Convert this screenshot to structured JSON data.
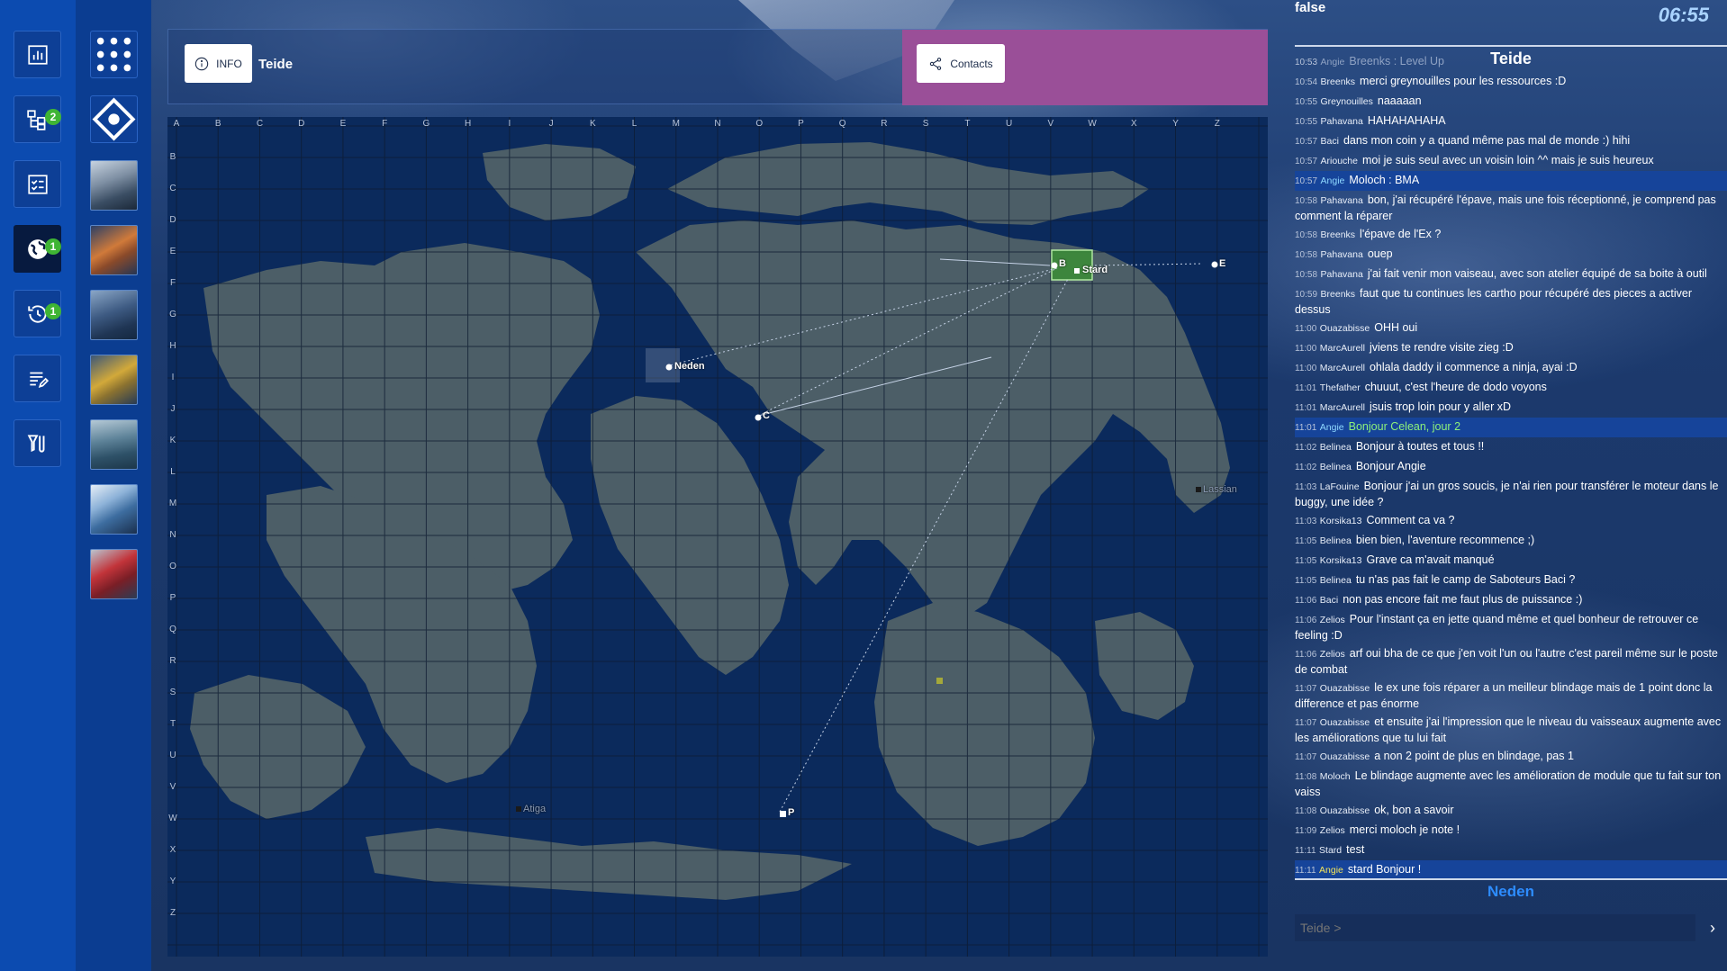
{
  "status_text": "false",
  "clock": "06:55",
  "topbar": {
    "info_label": "INFO",
    "location": "Teide",
    "contacts_label": "Contacts"
  },
  "nav": {
    "badges": {
      "hierarchy": "2",
      "world": "1",
      "history": "1"
    }
  },
  "map": {
    "columns": [
      "A",
      "B",
      "C",
      "D",
      "E",
      "F",
      "G",
      "H",
      "I",
      "J",
      "K",
      "L",
      "M",
      "N",
      "O",
      "P",
      "Q",
      "R",
      "S",
      "T",
      "U",
      "V",
      "W",
      "X",
      "Y",
      "Z"
    ],
    "rows": [
      "A",
      "B",
      "C",
      "D",
      "E",
      "F",
      "G",
      "H",
      "I",
      "J",
      "K",
      "L",
      "M",
      "N",
      "O",
      "P",
      "Q",
      "R",
      "S",
      "T",
      "U",
      "V",
      "W",
      "X",
      "Y",
      "Z"
    ],
    "markers": {
      "neden": "Neden",
      "c": "C",
      "b": "B",
      "stard": "Stard",
      "e": "E",
      "lassian": "Lassian",
      "atiga": "Atiga",
      "p": "P"
    }
  },
  "chat": {
    "channel": "Teide",
    "footer_channel": "Neden",
    "input_placeholder": "Teide >",
    "send_icon": "chevron-right-icon",
    "messages": [
      {
        "time": "10:53",
        "user": "Angie",
        "text": "Breenks : Level Up",
        "style": "dim"
      },
      {
        "time": "10:54",
        "user": "Breenks",
        "text": "merci greynouilles pour les ressources :D",
        "style": ""
      },
      {
        "time": "10:55",
        "user": "Greynouilles",
        "text": "naaaaan",
        "style": ""
      },
      {
        "time": "10:55",
        "user": "Pahavana",
        "text": "HAHAHAHAHA",
        "style": ""
      },
      {
        "time": "10:57",
        "user": "Baci",
        "text": "dans mon coin y a quand même pas mal de monde :) hihi",
        "style": ""
      },
      {
        "time": "10:57",
        "user": "Ariouche",
        "text": "moi je suis seul avec un voisin loin ^^ mais je suis heureux",
        "style": ""
      },
      {
        "time": "10:57",
        "user": "Angie",
        "text": "Moloch : BMA",
        "style": "hl"
      },
      {
        "time": "10:58",
        "user": "Pahavana",
        "text": "bon, j'ai récupéré l'épave, mais une fois réceptionné, je comprend pas comment la réparer",
        "style": ""
      },
      {
        "time": "10:58",
        "user": "Breenks",
        "text": "l'épave de l'Ex ?",
        "style": ""
      },
      {
        "time": "10:58",
        "user": "Pahavana",
        "text": "ouep",
        "style": ""
      },
      {
        "time": "10:58",
        "user": "Pahavana",
        "text": "j'ai fait venir mon vaiseau, avec son atelier équipé de sa boite à outil",
        "style": ""
      },
      {
        "time": "10:59",
        "user": "Breenks",
        "text": "faut que tu continues les cartho pour récupéré des pieces a activer dessus",
        "style": ""
      },
      {
        "time": "11:00",
        "user": "Ouazabisse",
        "text": "OHH oui",
        "style": ""
      },
      {
        "time": "11:00",
        "user": "MarcAurell",
        "text": "jviens te rendre visite zieg :D",
        "style": ""
      },
      {
        "time": "11:00",
        "user": "MarcAurell",
        "text": "ohlala daddy il commence a ninja, ayai :D",
        "style": ""
      },
      {
        "time": "11:01",
        "user": "Thefather",
        "text": "chuuut, c'est l'heure de dodo voyons",
        "style": ""
      },
      {
        "time": "11:01",
        "user": "MarcAurell",
        "text": "jsuis trop loin pour y aller xD",
        "style": ""
      },
      {
        "time": "11:01",
        "user": "Angie",
        "text": "Bonjour Celean, jour 2",
        "style": "hl green"
      },
      {
        "time": "11:02",
        "user": "Belinea",
        "text": "Bonjour à toutes et tous !!",
        "style": ""
      },
      {
        "time": "11:02",
        "user": "Belinea",
        "text": "Bonjour Angie",
        "style": ""
      },
      {
        "time": "11:03",
        "user": "LaFouine",
        "text": "Bonjour j'ai un gros soucis, je n'ai rien pour transférer le moteur dans le buggy, une idée ?",
        "style": ""
      },
      {
        "time": "11:03",
        "user": "Korsika13",
        "text": "Comment ca va ?",
        "style": ""
      },
      {
        "time": "11:05",
        "user": "Belinea",
        "text": "bien bien, l'aventure recommence ;)",
        "style": ""
      },
      {
        "time": "11:05",
        "user": "Korsika13",
        "text": "Grave ca m'avait manqué",
        "style": ""
      },
      {
        "time": "11:05",
        "user": "Belinea",
        "text": "tu n'as pas fait le camp de Saboteurs Baci ?",
        "style": ""
      },
      {
        "time": "11:06",
        "user": "Baci",
        "text": "non pas encore fait me faut plus de puissance :)",
        "style": ""
      },
      {
        "time": "11:06",
        "user": "Zelios",
        "text": "Pour l'instant ça en jette quand même et quel bonheur de retrouver ce feeling :D",
        "style": ""
      },
      {
        "time": "11:06",
        "user": "Zelios",
        "text": "arf oui bha de ce que j'en voit l'un ou l'autre c'est pareil même sur le poste de combat",
        "style": ""
      },
      {
        "time": "11:07",
        "user": "Ouazabisse",
        "text": "le ex une fois réparer a un meilleur blindage mais de 1 point donc la difference et pas énorme",
        "style": ""
      },
      {
        "time": "11:07",
        "user": "Ouazabisse",
        "text": "et ensuite j'ai l'impression que le niveau du vaisseaux augmente avec les améliorations que tu lui fait",
        "style": ""
      },
      {
        "time": "11:07",
        "user": "Ouazabisse",
        "text": "a non 2 point de plus en blindage, pas 1",
        "style": ""
      },
      {
        "time": "11:08",
        "user": "Moloch",
        "text": "Le blindage augmente avec les amélioration de module que tu fait sur ton vaiss",
        "style": ""
      },
      {
        "time": "11:08",
        "user": "Ouazabisse",
        "text": "ok, bon a savoir",
        "style": ""
      },
      {
        "time": "11:09",
        "user": "Zelios",
        "text": "merci moloch je note !",
        "style": ""
      },
      {
        "time": "11:11",
        "user": "Stard",
        "text": "test",
        "style": ""
      },
      {
        "time": "11:11",
        "user": "Angie",
        "text": "stard Bonjour !",
        "style": "hl gold"
      }
    ]
  },
  "colors": {
    "nav_bg": "#0c4bb0",
    "contacts_bg": "#9a4f98",
    "badge": "#3fb534",
    "highlight_row": "#16449a",
    "land": "#4c5e67",
    "ocean": "#0b2a5c",
    "footer_channel": "#2d8cff"
  }
}
